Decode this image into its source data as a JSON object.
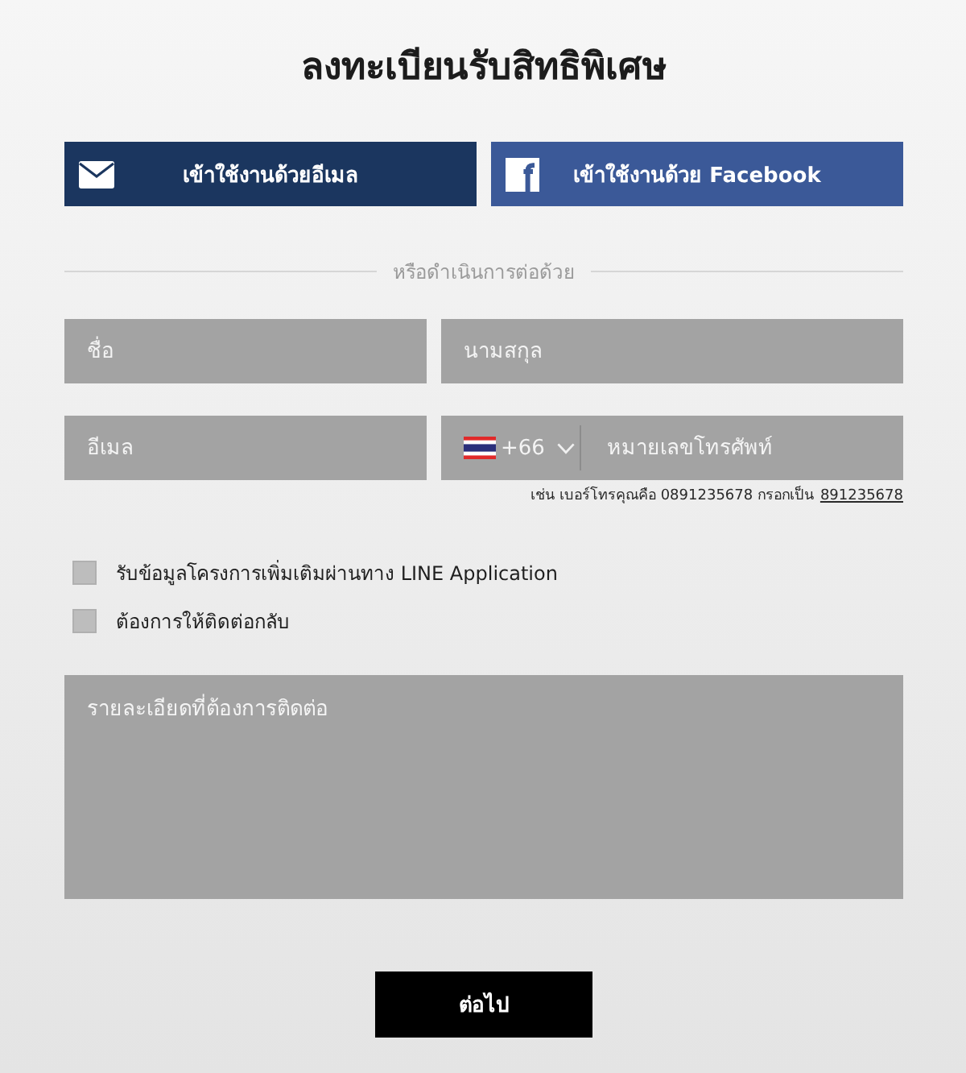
{
  "title": "ลงทะเบียนรับสิทธิพิเศษ",
  "login_buttons": [
    {
      "kind": "email",
      "label": "เข้าใช้งานด้วยอีเมล"
    },
    {
      "kind": "facebook",
      "label": "เข้าใช้งานด้วย Facebook"
    }
  ],
  "divider_text": "หรือดำเนินการต่อด้วย",
  "fields": [
    {
      "kind": "text",
      "placeholder": "ชื่อ"
    },
    {
      "kind": "text",
      "placeholder": "นามสกุล"
    },
    {
      "kind": "text",
      "placeholder": "อีเมล"
    },
    {
      "kind": "phone",
      "country_code": "+66",
      "placeholder": "หมายเลขโทรศัพท์"
    }
  ],
  "phone_hint": {
    "text": "เช่น เบอร์โทรคุณคือ 0891235678 กรอกเป็น",
    "example": "891235678"
  },
  "checkboxes": [
    {
      "label": "รับข้อมูลโครงการเพิ่มเติมผ่านทาง LINE Application",
      "checked": false
    },
    {
      "label": "ต้องการให้ติดต่อกลับ",
      "checked": false
    }
  ],
  "message": {
    "placeholder": "รายละเอียดที่ต้องการติดต่อ"
  },
  "submit_button": {
    "label": "ต่อไป"
  }
}
